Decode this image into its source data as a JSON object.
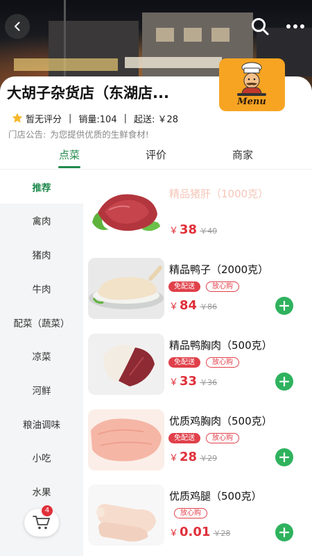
{
  "header": {
    "store_name": "大胡子杂货店（东湖店...",
    "logo_text": "Menu",
    "rating": "暂无评分",
    "sales": "销量:104",
    "min_order": "起送: ￥28",
    "notice_label": "门店公告:",
    "notice_text": "为您提供优质的生鲜食材!"
  },
  "tabs": [
    {
      "label": "点菜",
      "active": true
    },
    {
      "label": "评价",
      "active": false
    },
    {
      "label": "商家",
      "active": false
    }
  ],
  "sidebar": {
    "items": [
      {
        "label": "推荐",
        "active": true
      },
      {
        "label": "禽肉"
      },
      {
        "label": "猪肉"
      },
      {
        "label": "牛肉"
      },
      {
        "label": "配菜（蔬菜）"
      },
      {
        "label": "凉菜"
      },
      {
        "label": "河鲜"
      },
      {
        "label": "粮油调味"
      },
      {
        "label": "小吃"
      },
      {
        "label": "水果"
      }
    ]
  },
  "products": [
    {
      "name": "精品猪肝（1000克）",
      "price": "38",
      "old_price": "￥40",
      "badges": [],
      "currency": "￥"
    },
    {
      "name": "精品鸭子（2000克）",
      "price": "84",
      "old_price": "￥86",
      "badges": [
        "免配送",
        "放心购"
      ],
      "currency": "￥"
    },
    {
      "name": "精品鸭胸肉（500克）",
      "price": "33",
      "old_price": "￥36",
      "badges": [
        "免配送",
        "放心购"
      ],
      "currency": "￥"
    },
    {
      "name": "优质鸡胸肉（500克）",
      "price": "28",
      "old_price": "￥29",
      "badges": [
        "免配送",
        "放心购"
      ],
      "currency": "￥"
    },
    {
      "name": "优质鸡腿（500克）",
      "price": "0.01",
      "old_price": "￥28",
      "badges": [
        "放心购"
      ],
      "currency": "￥"
    }
  ],
  "cart": {
    "count": "4"
  },
  "colors": {
    "accent": "#1f8a4c",
    "price": "#e0303a",
    "add_button": "#2fb25e",
    "logo_bg": "#f7a423"
  }
}
